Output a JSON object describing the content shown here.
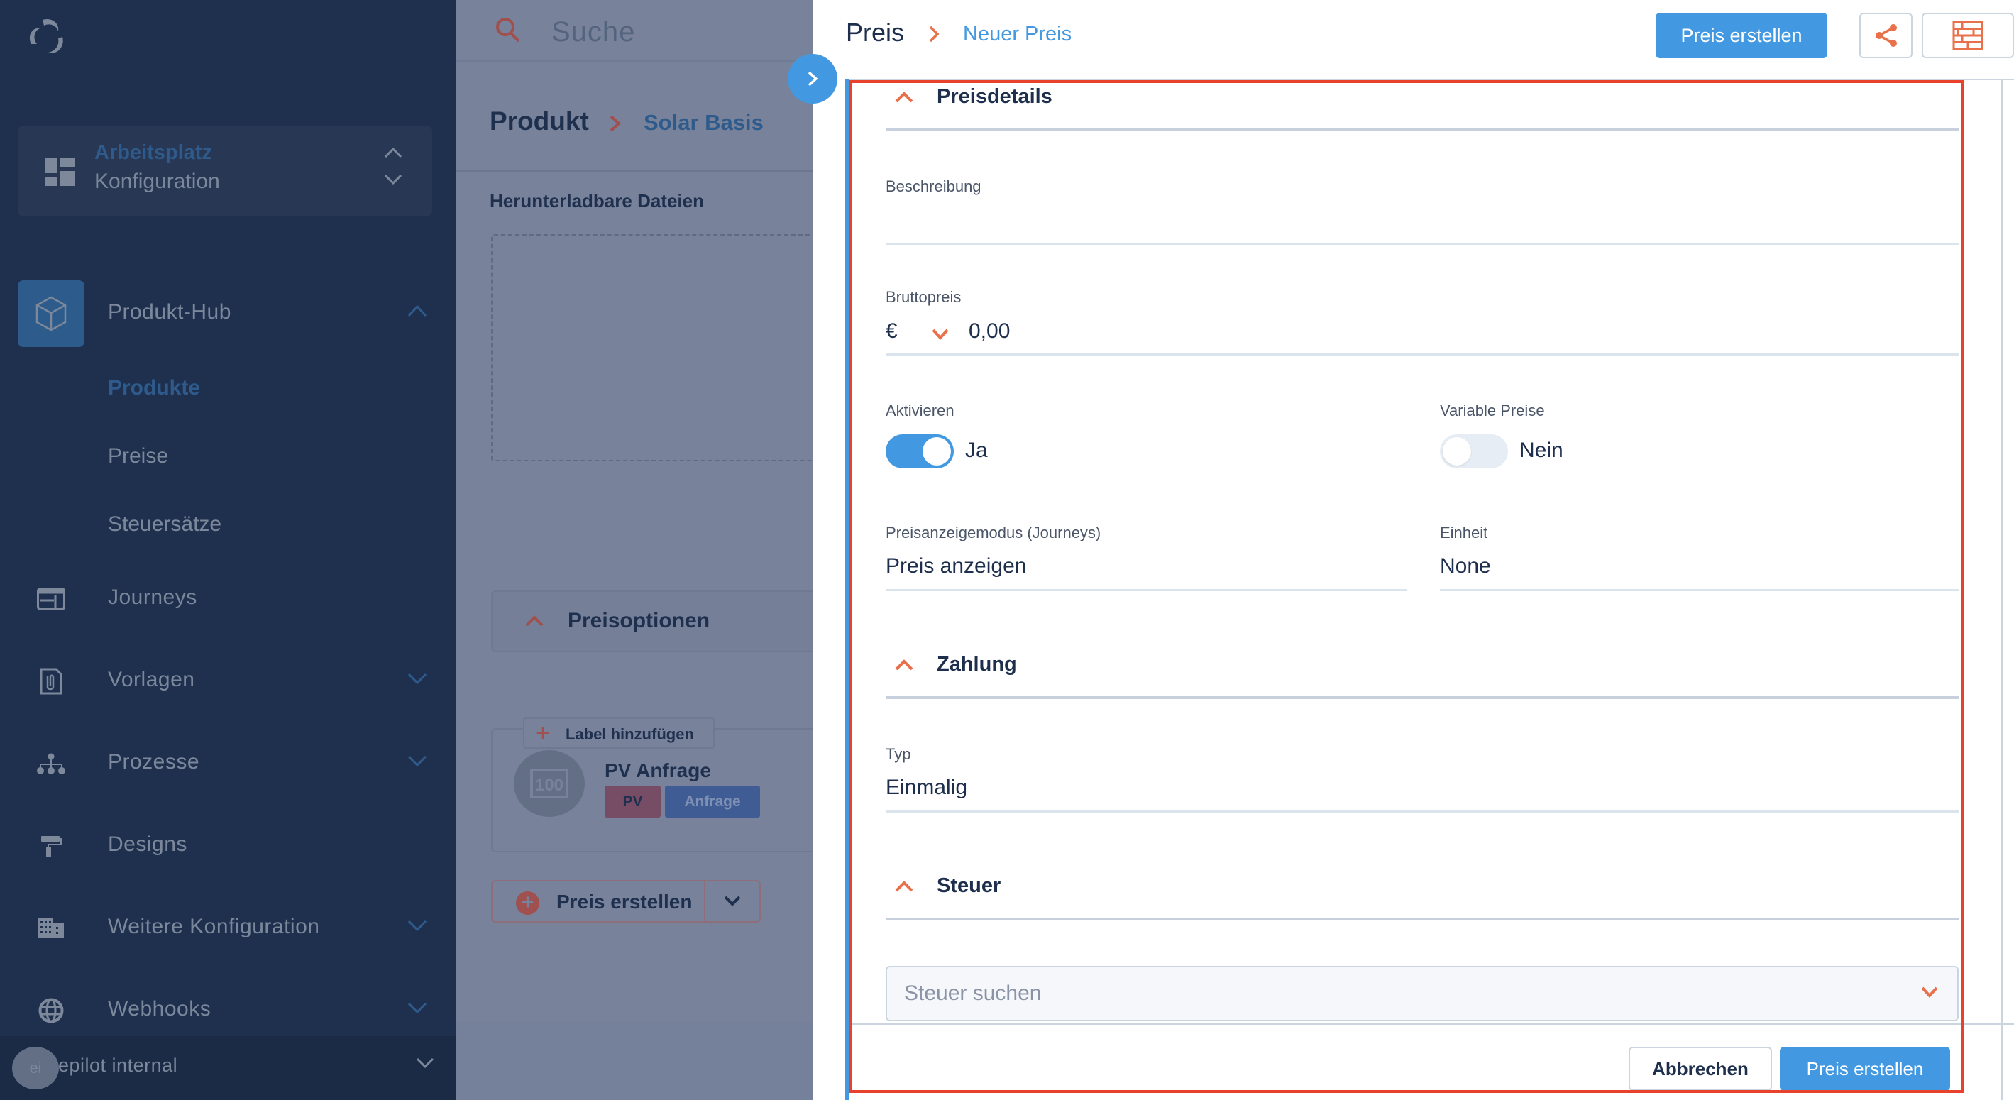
{
  "sidebar": {
    "workspace": {
      "title": "Arbeitsplatz",
      "subtitle": "Konfiguration"
    },
    "items": [
      {
        "label": "Produkt-Hub",
        "icon": "cube-icon",
        "expanded": true,
        "active": true
      },
      {
        "label": "Journeys",
        "icon": "browser-window-icon"
      },
      {
        "label": "Vorlagen",
        "icon": "paperclip-file-icon",
        "expandable": true
      },
      {
        "label": "Prozesse",
        "icon": "sitemap-icon",
        "expandable": true
      },
      {
        "label": "Designs",
        "icon": "paint-roller-icon"
      },
      {
        "label": "Weitere Konfiguration",
        "icon": "building-icon",
        "expandable": true
      },
      {
        "label": "Webhooks",
        "icon": "globe-icon",
        "expandable": true
      }
    ],
    "subitems": [
      {
        "label": "Produkte",
        "active": true
      },
      {
        "label": "Preise"
      },
      {
        "label": "Steuersätze"
      }
    ],
    "user": {
      "initials": "ei",
      "name": "epilot internal"
    }
  },
  "middle": {
    "search_placeholder": "Suche",
    "breadcrumb": {
      "root": "Produkt",
      "current": "Solar Basis"
    },
    "files_title": "Herunterladbare Dateien",
    "price_options_title": "Preisoptionen",
    "add_label": "Label hinzufügen",
    "card": {
      "title": "PV Anfrage",
      "tags": [
        "PV",
        "Anfrage"
      ]
    },
    "create_price_label": "Preis erstellen"
  },
  "drawer": {
    "breadcrumb": {
      "root": "Preis",
      "current": "Neuer Preis"
    },
    "create_button": "Preis erstellen",
    "sections": {
      "details": "Preisdetails",
      "payment": "Zahlung",
      "tax": "Steuer"
    },
    "fields": {
      "description": {
        "label": "Beschreibung",
        "value": ""
      },
      "gross_price": {
        "label": "Bruttopreis",
        "currency": "€",
        "value": "0,00"
      },
      "activate": {
        "label": "Aktivieren",
        "value": "Ja",
        "on": true
      },
      "variable_price": {
        "label": "Variable Preise",
        "value": "Nein",
        "on": false
      },
      "display_mode": {
        "label": "Preisanzeigemodus (Journeys)",
        "value": "Preis anzeigen"
      },
      "unit": {
        "label": "Einheit",
        "value": "None"
      },
      "type": {
        "label": "Typ",
        "value": "Einmalig"
      },
      "tax_search": {
        "placeholder": "Steuer suchen"
      }
    },
    "footer": {
      "cancel": "Abbrechen",
      "submit": "Preis erstellen"
    }
  },
  "colors": {
    "accent_blue": "#4299e1",
    "accent_orange": "#e8704a",
    "highlight_red": "#e8412c",
    "sidebar_bg": "#1f304f"
  }
}
